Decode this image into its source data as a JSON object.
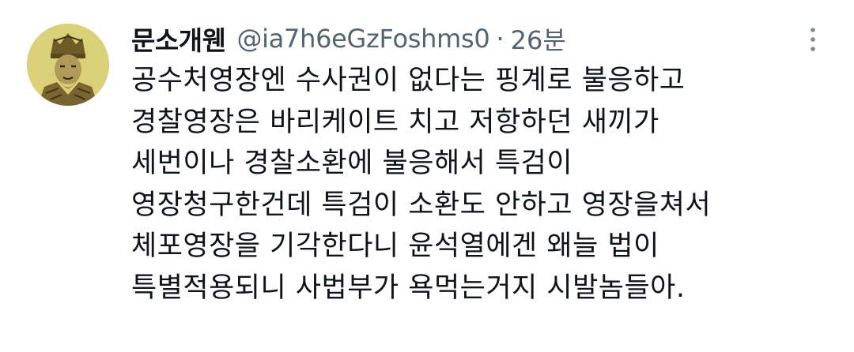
{
  "tweet": {
    "display_name": "문소개웬",
    "handle": "@ia7h6eGzFoshms0",
    "separator": "·",
    "time": "26분",
    "avatar_icon": "warrior-portrait-icon",
    "more_icon": "more-vertical-icon",
    "lines": [
      "공수처영장엔 수사권이 없다는 핑계로 불응하고",
      "경찰영장은 바리케이트 치고 저항하던 새끼가",
      "세번이나 경찰소환에 불응해서 특검이",
      "영장청구한건데 특검이 소환도 안하고 영장을쳐서",
      "체포영장을 기각한다니 윤석열에겐 왜늘 법이",
      "특별적용되니 사법부가 욕먹는거지 시발놈들아."
    ]
  }
}
